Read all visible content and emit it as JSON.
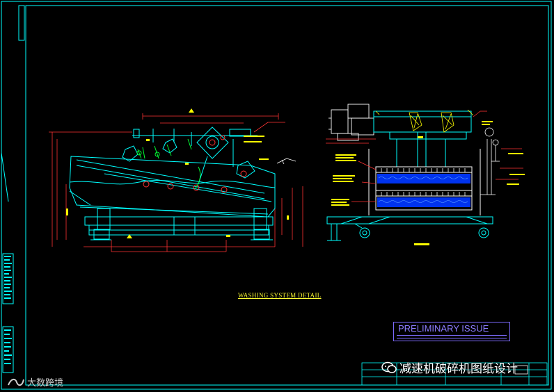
{
  "drawing": {
    "caption": "WASHING SYSTEM DETAIL",
    "stamp": "PRELIMINARY ISSUE"
  },
  "watermarks": {
    "right_text": "减速机破碎机图纸设计",
    "left_text": "大数跨境",
    "right_icon": "wechat-icon",
    "left_icon": "brand-logo-icon"
  },
  "colors": {
    "background": "#000000",
    "frame": "#00ffff",
    "outline": "#00ffff",
    "dimension": "#ff3333",
    "label": "#ffff00",
    "nozzle": "#00ff33",
    "water": "#0044ff",
    "stamp": "#7d6bff",
    "white": "#ffffff"
  }
}
